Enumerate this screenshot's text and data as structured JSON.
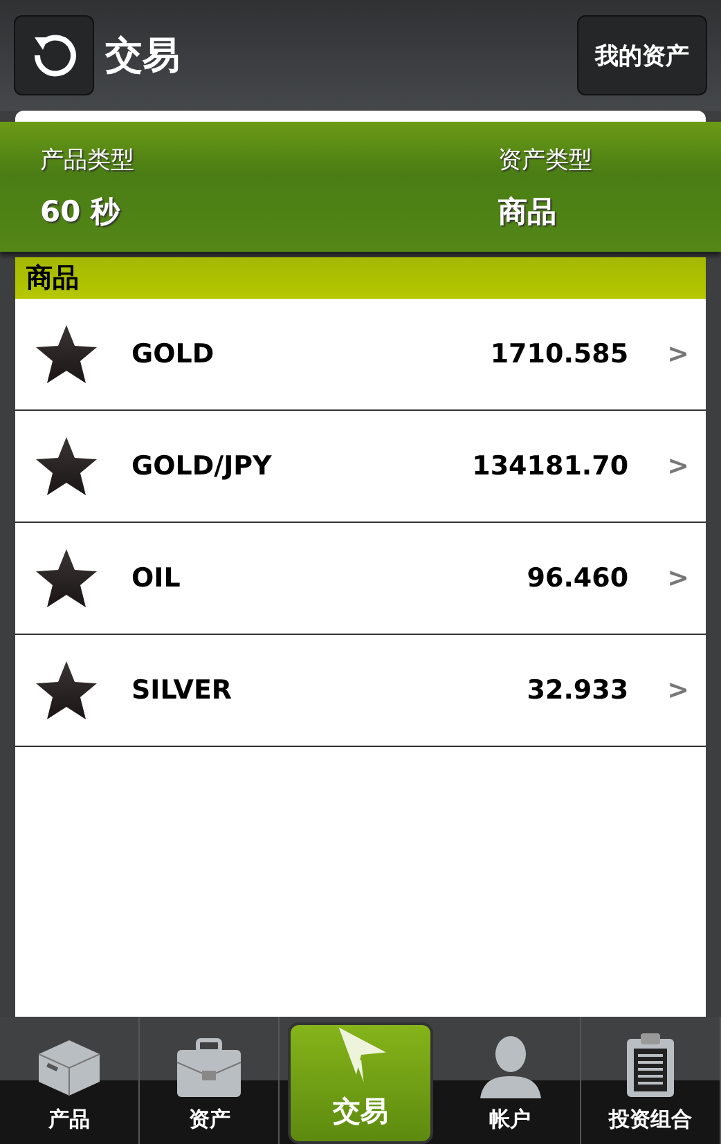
{
  "header": {
    "title": "交易",
    "right_button": "我的资产"
  },
  "info": [
    {
      "label": "产品类型",
      "value": "60 秒"
    },
    {
      "label": "资产类型",
      "value": "商品"
    }
  ],
  "section": "商品",
  "rows": [
    {
      "name": "GOLD",
      "price": "1710.585",
      "chevron": ">"
    },
    {
      "name": "GOLD/JPY",
      "price": "134181.70",
      "chevron": ">"
    },
    {
      "name": "OIL",
      "price": "96.460",
      "chevron": ">"
    },
    {
      "name": "SILVER",
      "price": "32.933",
      "chevron": ">"
    }
  ],
  "tabs": [
    {
      "label": "产品",
      "kind": "box",
      "selected": false
    },
    {
      "label": "资产",
      "kind": "briefcase",
      "selected": false
    },
    {
      "label": "交易",
      "kind": "plane",
      "selected": true
    },
    {
      "label": "帐户",
      "kind": "person",
      "selected": false
    },
    {
      "label": "投资组合",
      "kind": "clipboard",
      "selected": false
    }
  ]
}
